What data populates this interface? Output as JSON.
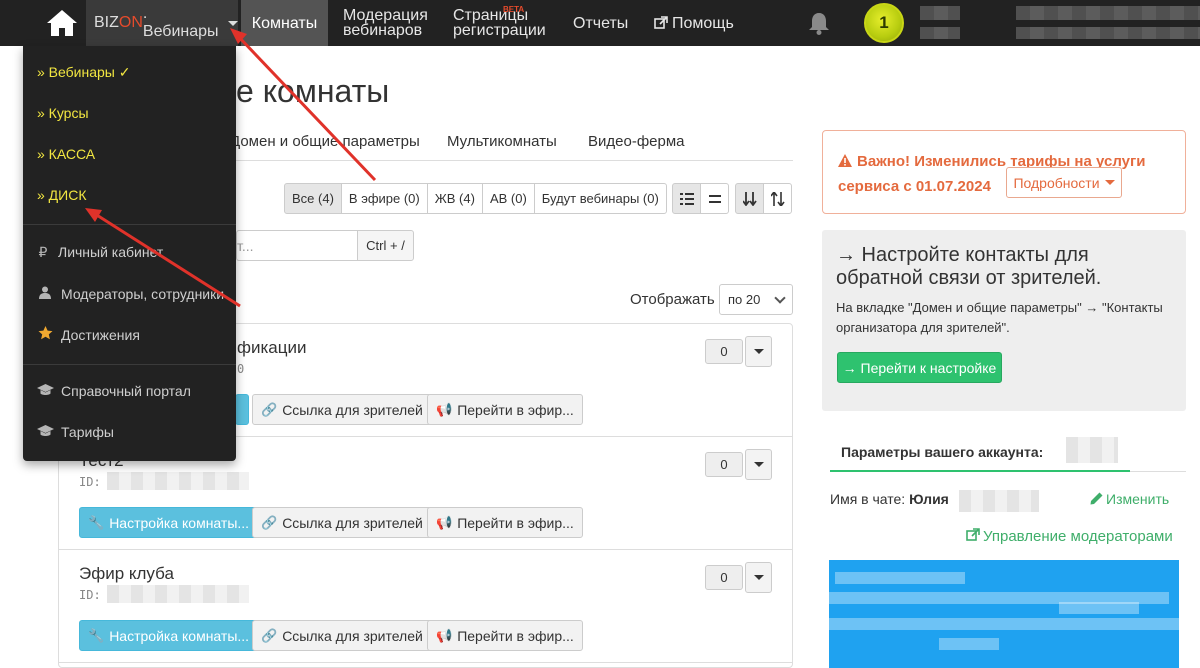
{
  "nav": {
    "brand_prefix": "BIZ",
    "brand_on": "ON",
    "brand_suffix": ". Вебинары",
    "rooms": "Комнаты",
    "moderation_1": "Модерация",
    "moderation_2": "вебинаров",
    "registration_1": "Страницы",
    "registration_2": "регистрации",
    "beta": "BETA",
    "reports": "Отчеты",
    "help": "Помощь",
    "badge": "1"
  },
  "dropdown": {
    "items": [
      {
        "label": "» Вебинары",
        "check": "✓"
      },
      {
        "label": "» Курсы"
      },
      {
        "label": "» КАССА"
      },
      {
        "label": "» ДИСК"
      },
      {
        "label": "Личный кабинет",
        "icon": "₽"
      },
      {
        "label": "Модераторы, сотрудники"
      },
      {
        "label": "Достижения"
      },
      {
        "label": "Справочный портал"
      },
      {
        "label": "Тарифы"
      }
    ]
  },
  "main": {
    "title": "е комнаты",
    "tabs": [
      "Домен и общие параметры",
      "Мультикомнаты",
      "Видео-ферма"
    ],
    "filters": [
      "Все (4)",
      "В эфире (0)",
      "ЖВ (4)",
      "АВ (0)",
      "Будут вебинары (0)"
    ],
    "search_placeholder": "т...",
    "ctrl_hint": "Ctrl + /",
    "show_label": "Отображать",
    "per_page": "по 20",
    "rooms": [
      {
        "name": "фикации",
        "id_suffix": "0",
        "count": "0",
        "btn_setup": "",
        "btn_link": "Ссылка для зрителей",
        "btn_live": "Перейти в эфир..."
      },
      {
        "name": "Тест2",
        "id_label": "ID:",
        "count": "0",
        "btn_setup": "Настройка комнаты...",
        "btn_link": "Ссылка для зрителей",
        "btn_live": "Перейти в эфир..."
      },
      {
        "name": "Эфир клуба",
        "id_label": "ID:",
        "count": "0",
        "btn_setup": "Настройка комнаты...",
        "btn_link": "Ссылка для зрителей",
        "btn_live": "Перейти в эфир..."
      }
    ]
  },
  "side": {
    "alert_text": "Важно! Изменились тарифы на услуги сервиса с 01.07.2024",
    "alert_btn": "Подробности",
    "setup_title": "→ Настройте контакты для обратной связи от зрителей.",
    "setup_desc": "На вкладке \"Домен и общие параметры\" → \"Контакты организатора для зрителей\".",
    "setup_btn": "→ Перейти к настройке",
    "acct_tab": "Параметры вашего аккаунта:",
    "nick_label": "Имя в чате:",
    "nick_value": "Юлия",
    "edit": "Изменить",
    "moderators": "Управление модераторами"
  },
  "colors": {
    "navbar": "#222222",
    "accent_orange": "#e46a3e",
    "menu_yellow": "#f2e641",
    "success_green": "#2ec26f",
    "info_blue": "#5bc0de",
    "arrow_red": "#e0322a"
  }
}
